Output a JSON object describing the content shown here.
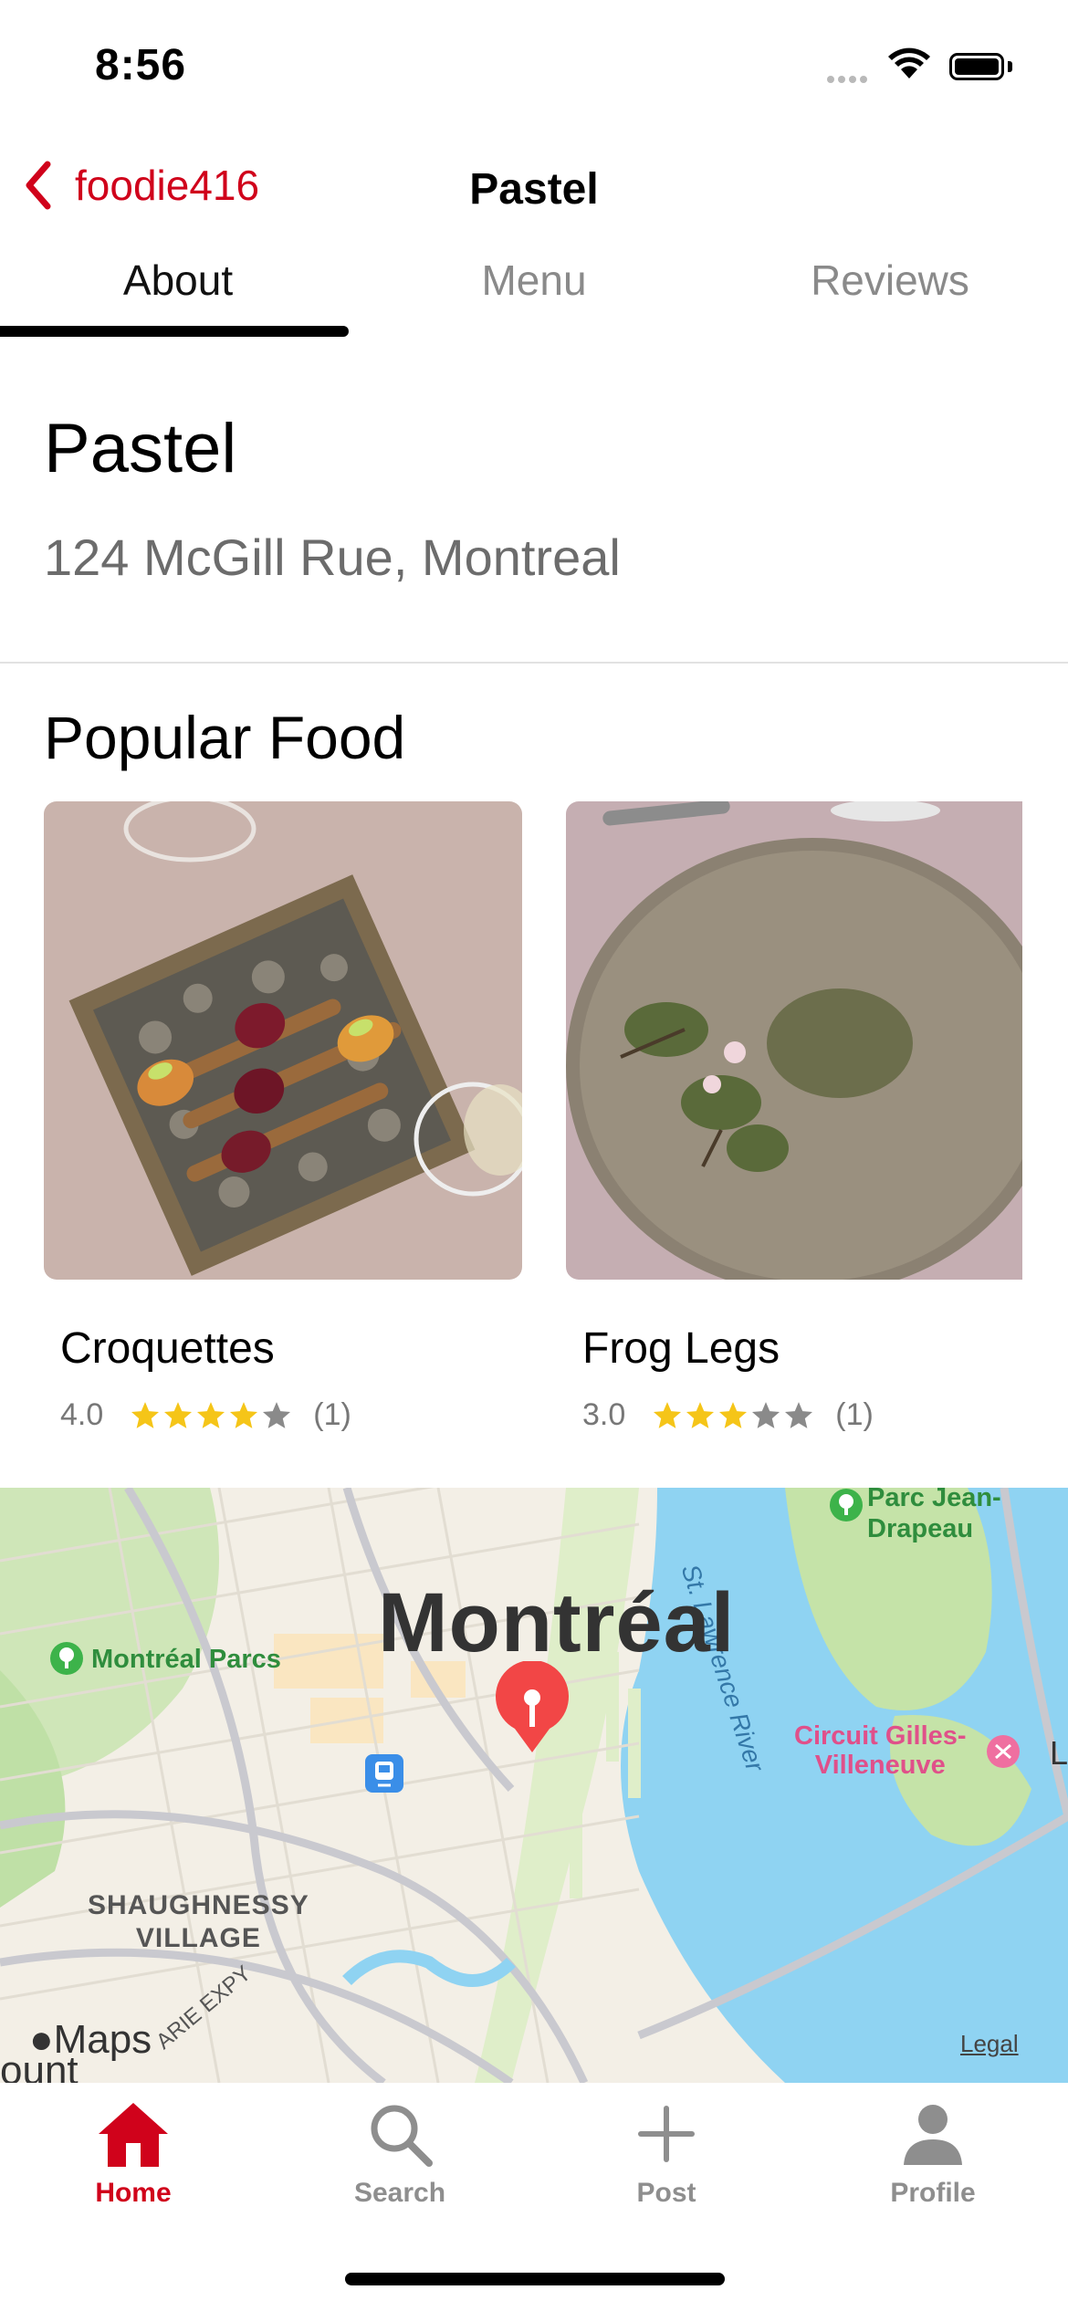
{
  "status_bar": {
    "time": "8:56"
  },
  "header": {
    "back_label": "foodie416",
    "title": "Pastel"
  },
  "tabs": [
    {
      "label": "About",
      "active": true
    },
    {
      "label": "Menu",
      "active": false
    },
    {
      "label": "Reviews",
      "active": false
    }
  ],
  "restaurant": {
    "name": "Pastel",
    "address": "124 McGill Rue, Montreal"
  },
  "popular_food": {
    "title": "Popular Food",
    "items": [
      {
        "name": "Croquettes",
        "rating": "4.0",
        "stars": 4,
        "count": "(1)"
      },
      {
        "name": "Frog Legs",
        "rating": "3.0",
        "stars": 3,
        "count": "(1)"
      }
    ]
  },
  "map": {
    "city": "Montréal",
    "labels": {
      "parcs": "Montréal Parcs",
      "river": "St. Lawrence River",
      "park_jean": "Parc Jean-\nDrapeau",
      "circuit": "Circuit Gilles-\nVilleneuve",
      "shaughnessy": "SHAUGHNESSY\nVILLAGE",
      "expy": "ARIE EXPY",
      "partial_left": "ount",
      "partial_right": "L"
    },
    "attribution": "Maps",
    "legal": "Legal"
  },
  "tab_bar": [
    {
      "label": "Home",
      "icon": "home-icon",
      "active": true
    },
    {
      "label": "Search",
      "icon": "search-icon",
      "active": false
    },
    {
      "label": "Post",
      "icon": "plus-icon",
      "active": false
    },
    {
      "label": "Profile",
      "icon": "person-icon",
      "active": false
    }
  ],
  "colors": {
    "accent": "#d0021b",
    "star": "#f5c518",
    "star_empty": "#8a8a8a"
  }
}
